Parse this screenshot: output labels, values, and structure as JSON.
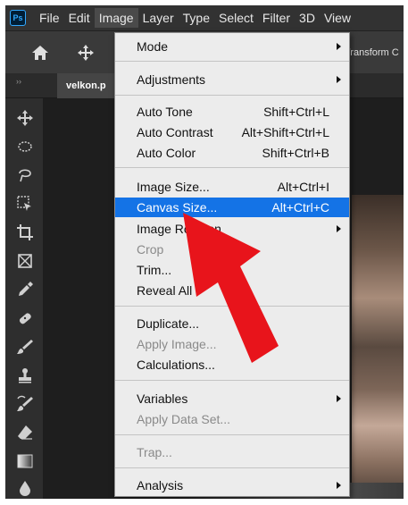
{
  "app": {
    "logo": "Ps"
  },
  "menubar": {
    "items": [
      {
        "label": "File"
      },
      {
        "label": "Edit"
      },
      {
        "label": "Image"
      },
      {
        "label": "Layer"
      },
      {
        "label": "Type"
      },
      {
        "label": "Select"
      },
      {
        "label": "Filter"
      },
      {
        "label": "3D"
      },
      {
        "label": "View"
      }
    ],
    "active": "Image"
  },
  "options_bar": {
    "home_icon": "home-icon",
    "move_icon": "move-icon",
    "transform_label": "Transform C"
  },
  "tabbar": {
    "collapse_glyph": "››",
    "document_tab": "velkon.p"
  },
  "toolbar": {
    "tools": [
      "move-tool",
      "marquee-tool",
      "lasso-tool",
      "object-select-tool",
      "crop-tool",
      "frame-tool",
      "eyedropper-tool",
      "healing-tool",
      "brush-tool",
      "stamp-tool",
      "history-brush-tool",
      "eraser-tool",
      "gradient-tool",
      "blur-tool"
    ]
  },
  "image_menu": {
    "mode": "Mode",
    "adjustments": "Adjustments",
    "auto_tone": {
      "label": "Auto Tone",
      "shortcut": "Shift+Ctrl+L"
    },
    "auto_contrast": {
      "label": "Auto Contrast",
      "shortcut": "Alt+Shift+Ctrl+L"
    },
    "auto_color": {
      "label": "Auto Color",
      "shortcut": "Shift+Ctrl+B"
    },
    "image_size": {
      "label": "Image Size...",
      "shortcut": "Alt+Ctrl+I"
    },
    "canvas_size": {
      "label": "Canvas Size...",
      "shortcut": "Alt+Ctrl+C"
    },
    "image_rotation": "Image Rotation",
    "crop": "Crop",
    "trim": "Trim...",
    "reveal_all": "Reveal All",
    "duplicate": "Duplicate...",
    "apply_image": "Apply Image...",
    "calculations": "Calculations...",
    "variables": "Variables",
    "apply_data_set": "Apply Data Set...",
    "trap": "Trap...",
    "analysis": "Analysis"
  },
  "colors": {
    "highlight": "#1473e6",
    "annotation_arrow": "#e8141b",
    "ps_blue": "#31a8ff"
  }
}
